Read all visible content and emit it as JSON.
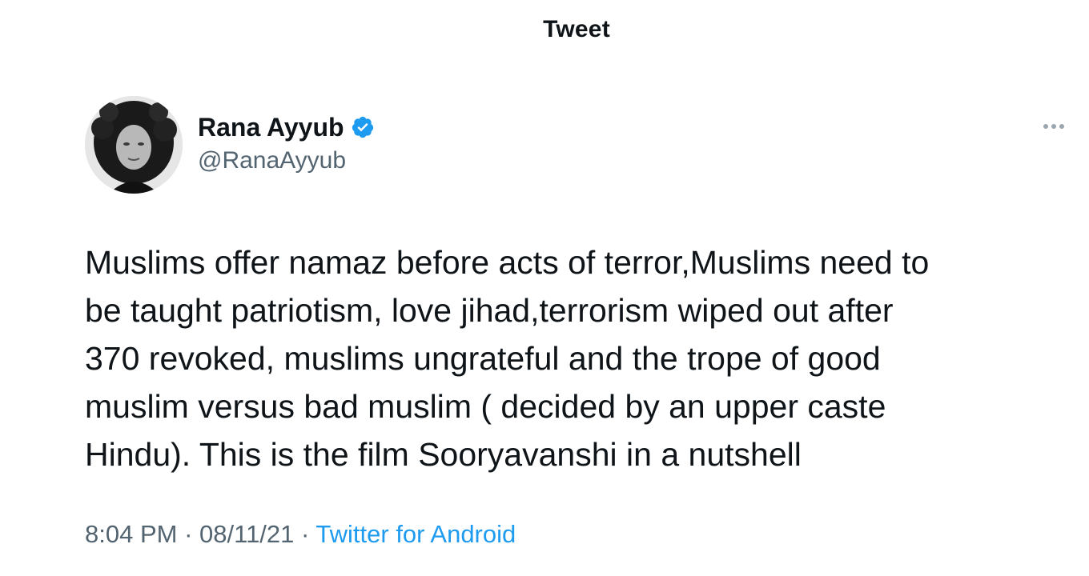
{
  "header": {
    "title": "Tweet"
  },
  "author": {
    "name": "Rana Ayyub",
    "handle": "@RanaAyyub",
    "verified": true,
    "verified_color": "#1d9bf0"
  },
  "tweet": {
    "lines": [
      "Muslims offer namaz before acts of terror,Muslims need to",
      "be taught patriotism, love jihad,terrorism wiped out after",
      "370 revoked, muslims ungrateful and the trope of good",
      "muslim versus bad muslim ( decided by an upper caste",
      "Hindu). This is the film Sooryavanshi in a nutshell"
    ],
    "time": "8:04 PM",
    "separator": "·",
    "date": "08/11/21",
    "source": "Twitter for Android"
  },
  "icons": {
    "verified": "verified-badge-icon",
    "more": "more-options-icon"
  },
  "colors": {
    "text": "#0f1419",
    "secondary": "#536471",
    "link": "#1d9bf0"
  }
}
